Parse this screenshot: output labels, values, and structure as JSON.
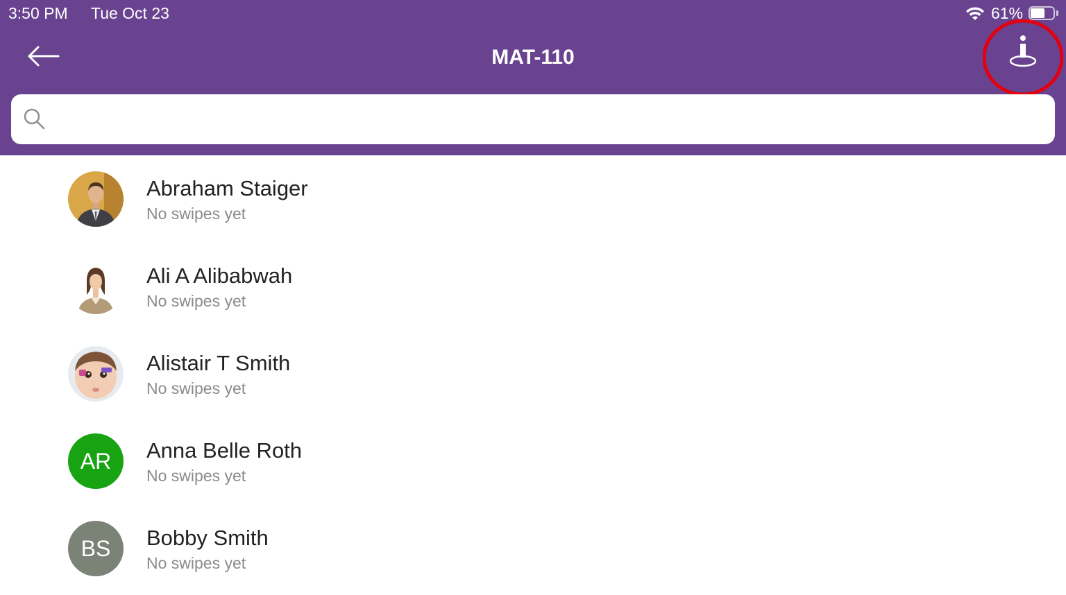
{
  "status_bar": {
    "time": "3:50 PM",
    "date": "Tue Oct 23",
    "battery_percent": "61%",
    "battery_level": 0.61,
    "icons": [
      "wifi-icon",
      "battery-icon"
    ]
  },
  "nav": {
    "title": "MAT-110",
    "back_icon": "arrow-left-icon",
    "action_icon": "person-location-icon",
    "highlight_color": "#e3000f"
  },
  "search": {
    "placeholder": "",
    "value": "",
    "icon": "search-icon"
  },
  "colors": {
    "header_bg": "#6a4390",
    "primary_text": "#222222",
    "secondary_text": "#8a8a8a"
  },
  "students": [
    {
      "name": "Abraham Staiger",
      "status": "No swipes yet",
      "avatar": "photo"
    },
    {
      "name": "Ali A Alibabwah",
      "status": "No swipes yet",
      "avatar": "photo"
    },
    {
      "name": "Alistair T Smith",
      "status": "No swipes yet",
      "avatar": "photo"
    },
    {
      "name": "Anna Belle Roth",
      "status": "No swipes yet",
      "avatar": "initials",
      "initials": "AR",
      "avatar_color": "#17a312"
    },
    {
      "name": "Bobby Smith",
      "status": "No swipes yet",
      "avatar": "initials",
      "initials": "BS",
      "avatar_color": "#7b8276"
    }
  ]
}
